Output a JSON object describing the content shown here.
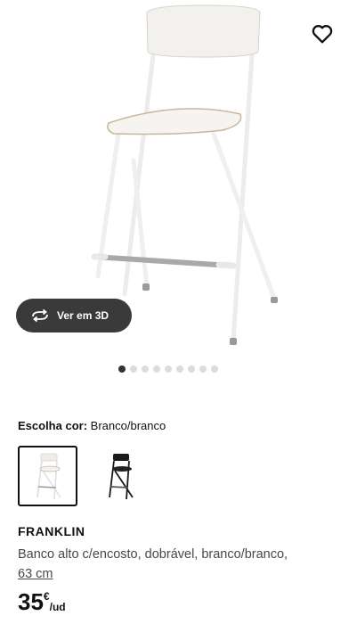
{
  "gallery": {
    "view_3d_label": "Ver em 3D",
    "image_count": 9,
    "active_index": 0
  },
  "icons": {
    "favorite": "heart-outline-icon",
    "view_3d": "rotate-3d-icon"
  },
  "color_selector": {
    "label": "Escolha cor:",
    "selected_value": "Branco/branco",
    "options": [
      {
        "name": "Branco/branco",
        "selected": true,
        "color": "#f2f0ec"
      },
      {
        "name": "Preto",
        "selected": false,
        "color": "#1a1a1a"
      }
    ]
  },
  "product": {
    "name": "FRANKLIN",
    "description": "Banco alto c/encosto, dobrável, branco/branco,",
    "size_link": "63 cm",
    "price_amount": "35",
    "price_currency": "€",
    "price_unit": "/ud"
  },
  "colors": {
    "text": "#111111",
    "secondary_text": "#484848",
    "button_bg": "#3a3a3a",
    "dot_active": "#333333",
    "dot_inactive": "#dcdcdc"
  }
}
